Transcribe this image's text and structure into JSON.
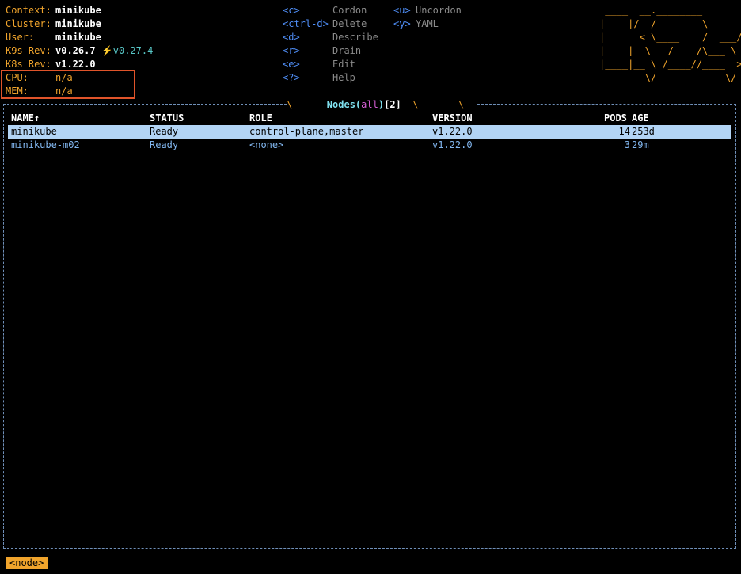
{
  "header": {
    "info": [
      {
        "key": "Context:",
        "value": "minikube"
      },
      {
        "key": "Cluster:",
        "value": "minikube"
      },
      {
        "key": "User:",
        "value": "minikube"
      },
      {
        "key": "K9s Rev:",
        "value": "v0.26.7",
        "extra": "⚡️v0.27.4"
      },
      {
        "key": "K8s Rev:",
        "value": "v1.22.0"
      }
    ],
    "metrics": [
      {
        "key": "CPU:",
        "value": "n/a"
      },
      {
        "key": "MEM:",
        "value": "n/a"
      }
    ]
  },
  "commands": [
    {
      "key": "<c>",
      "label": "Cordon"
    },
    {
      "key": "<ctrl-d>",
      "label": "Delete"
    },
    {
      "key": "<d>",
      "label": "Describe"
    },
    {
      "key": "<r>",
      "label": "Drain"
    },
    {
      "key": "<e>",
      "label": "Edit"
    },
    {
      "key": "<?>",
      "label": "Help"
    },
    {
      "key": "<u>",
      "label": "Uncordon"
    },
    {
      "key": "<y>",
      "label": "YAML"
    }
  ],
  "logo": [
    " ____  __.________",
    "|    |/ _/   __   \\______",
    "|      < \\____    /  ___/",
    "|    |  \\   /    /\\___ \\",
    "|____|__ \\ /____//____  >",
    "        \\/            \\/"
  ],
  "table": {
    "title": "Nodes",
    "filter": "all",
    "count": "2",
    "columns": [
      "NAME↑",
      "STATUS",
      "ROLE",
      "VERSION",
      "PODS",
      "AGE"
    ],
    "rows": [
      {
        "name": "minikube",
        "status": "Ready",
        "role": "control-plane,master",
        "version": "v1.22.0",
        "pods": "14",
        "age": "253d"
      },
      {
        "name": "minikube-m02",
        "status": "Ready",
        "role": "<none>",
        "version": "v1.22.0",
        "pods": "3",
        "age": "29m"
      }
    ]
  },
  "breadcrumb": "<node>",
  "colors": {
    "accent": "#f0a42c",
    "key": "#4f8ef7",
    "selected_row": "#b2d4f5",
    "highlight_box": "#e0542a"
  }
}
